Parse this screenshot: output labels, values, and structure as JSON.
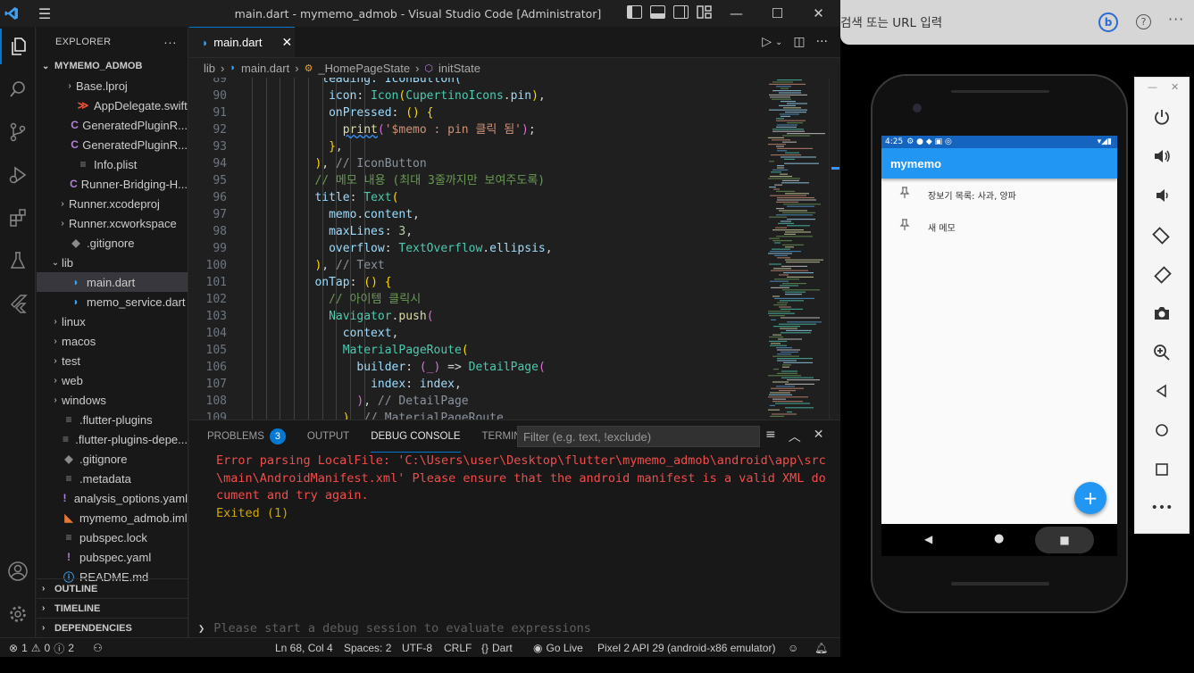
{
  "window": {
    "title": "main.dart - mymemo_admob - Visual Studio Code [Administrator]",
    "controls": {
      "minimize": "—",
      "maximize": "☐",
      "close": "✕"
    }
  },
  "activity_bar": [
    "explorer-icon",
    "search-icon",
    "source-control-icon",
    "run-debug-icon",
    "extensions-icon",
    "testing-icon",
    "flutter-icon",
    "account-icon",
    "settings-gear-icon"
  ],
  "sidebar": {
    "header": "EXPLORER",
    "more": "···",
    "root": "MYMEMO_ADMOB",
    "items": [
      {
        "label": "Base.lproj",
        "icon": "",
        "chevron": "›",
        "indent": 2
      },
      {
        "label": "AppDelegate.swift",
        "icon": "swift",
        "chevron": "",
        "indent": 2
      },
      {
        "label": "GeneratedPluginR...",
        "icon": "C",
        "chevron": "",
        "indent": 2
      },
      {
        "label": "GeneratedPluginR...",
        "icon": "C",
        "chevron": "",
        "indent": 2
      },
      {
        "label": "Info.plist",
        "icon": "≡",
        "chevron": "",
        "indent": 2
      },
      {
        "label": "Runner-Bridging-H...",
        "icon": "C",
        "chevron": "",
        "indent": 2
      },
      {
        "label": "Runner.xcodeproj",
        "icon": "",
        "chevron": "›",
        "indent": 1
      },
      {
        "label": "Runner.xcworkspace",
        "icon": "",
        "chevron": "›",
        "indent": 1
      },
      {
        "label": ".gitignore",
        "icon": "◆",
        "chevron": "",
        "indent": 1
      },
      {
        "label": "lib",
        "icon": "",
        "chevron": "⌄",
        "indent": 0
      },
      {
        "label": "main.dart",
        "icon": "dart",
        "chevron": "",
        "indent": 1,
        "selected": true
      },
      {
        "label": "memo_service.dart",
        "icon": "dart",
        "chevron": "",
        "indent": 1
      },
      {
        "label": "linux",
        "icon": "",
        "chevron": "›",
        "indent": 0
      },
      {
        "label": "macos",
        "icon": "",
        "chevron": "›",
        "indent": 0
      },
      {
        "label": "test",
        "icon": "",
        "chevron": "›",
        "indent": 0
      },
      {
        "label": "web",
        "icon": "",
        "chevron": "›",
        "indent": 0
      },
      {
        "label": "windows",
        "icon": "",
        "chevron": "›",
        "indent": 0
      },
      {
        "label": ".flutter-plugins",
        "icon": "≡",
        "chevron": "",
        "indent": 0
      },
      {
        "label": ".flutter-plugins-depe...",
        "icon": "≡",
        "chevron": "",
        "indent": 0
      },
      {
        "label": ".gitignore",
        "icon": "◆",
        "chevron": "",
        "indent": 0
      },
      {
        "label": ".metadata",
        "icon": "≡",
        "chevron": "",
        "indent": 0
      },
      {
        "label": "analysis_options.yaml",
        "icon": "!",
        "chevron": "",
        "indent": 0
      },
      {
        "label": "mymemo_admob.iml",
        "icon": "rss",
        "chevron": "",
        "indent": 0
      },
      {
        "label": "pubspec.lock",
        "icon": "≡",
        "chevron": "",
        "indent": 0
      },
      {
        "label": "pubspec.yaml",
        "icon": "!",
        "chevron": "",
        "indent": 0
      },
      {
        "label": "README.md",
        "icon": "ⓘ",
        "chevron": "",
        "indent": 0
      }
    ],
    "sections": [
      "OUTLINE",
      "TIMELINE",
      "DEPENDENCIES"
    ]
  },
  "editor": {
    "tab": "main.dart",
    "breadcrumb": [
      "lib",
      "main.dart",
      "_HomePageState",
      "initState"
    ],
    "lines": [
      {
        "n": "89",
        "html": "          leading: IconButton("
      },
      {
        "n": "90",
        "indent": 11,
        "tokens": [
          [
            "prop",
            "icon"
          ],
          [
            "p",
            ": "
          ],
          [
            "cls",
            "Icon"
          ],
          [
            "br",
            "("
          ],
          [
            "cls",
            "CupertinoIcons"
          ],
          [
            "p",
            "."
          ],
          [
            "prop",
            "pin"
          ],
          [
            "br",
            ")"
          ],
          [
            "p",
            ","
          ]
        ]
      },
      {
        "n": "91",
        "indent": 11,
        "tokens": [
          [
            "prop",
            "onPressed"
          ],
          [
            "p",
            ": "
          ],
          [
            "br",
            "() {"
          ]
        ]
      },
      {
        "n": "92",
        "indent": 13,
        "tokens": [
          [
            "fn",
            "print"
          ],
          [
            "br2",
            "("
          ],
          [
            "str",
            "'$memo : pin 클릭 됨'"
          ],
          [
            "br2",
            ")"
          ],
          [
            "p",
            ";"
          ]
        ]
      },
      {
        "n": "93",
        "indent": 11,
        "tokens": [
          [
            "br",
            "}"
          ],
          [
            "p",
            ","
          ]
        ]
      },
      {
        "n": "94",
        "indent": 9,
        "tokens": [
          [
            "br",
            ")"
          ],
          [
            "p",
            ", "
          ],
          [
            "cmtg",
            "// IconButton"
          ]
        ]
      },
      {
        "n": "95",
        "indent": 9,
        "tokens": [
          [
            "cmt",
            "// 메모 내용 (최대 3줄까지만 보여주도록)"
          ]
        ]
      },
      {
        "n": "96",
        "indent": 9,
        "tokens": [
          [
            "prop",
            "title"
          ],
          [
            "p",
            ": "
          ],
          [
            "cls",
            "Text"
          ],
          [
            "br",
            "("
          ]
        ]
      },
      {
        "n": "97",
        "indent": 11,
        "tokens": [
          [
            "prop",
            "memo"
          ],
          [
            "p",
            "."
          ],
          [
            "prop",
            "content"
          ],
          [
            "p",
            ","
          ]
        ]
      },
      {
        "n": "98",
        "indent": 11,
        "tokens": [
          [
            "prop",
            "maxLines"
          ],
          [
            "p",
            ": "
          ],
          [
            "num",
            "3"
          ],
          [
            "p",
            ","
          ]
        ]
      },
      {
        "n": "99",
        "indent": 11,
        "tokens": [
          [
            "prop",
            "overflow"
          ],
          [
            "p",
            ": "
          ],
          [
            "cls",
            "TextOverflow"
          ],
          [
            "p",
            "."
          ],
          [
            "prop",
            "ellipsis"
          ],
          [
            "p",
            ","
          ]
        ]
      },
      {
        "n": "100",
        "indent": 9,
        "tokens": [
          [
            "br",
            ")"
          ],
          [
            "p",
            ", "
          ],
          [
            "cmtg",
            "// Text"
          ]
        ]
      },
      {
        "n": "101",
        "indent": 9,
        "tokens": [
          [
            "prop",
            "onTap"
          ],
          [
            "p",
            ": "
          ],
          [
            "br",
            "() {"
          ]
        ]
      },
      {
        "n": "102",
        "indent": 11,
        "tokens": [
          [
            "cmt",
            "// 아이템 클릭시"
          ]
        ]
      },
      {
        "n": "103",
        "indent": 11,
        "tokens": [
          [
            "cls",
            "Navigator"
          ],
          [
            "p",
            "."
          ],
          [
            "fn",
            "push"
          ],
          [
            "br2",
            "("
          ]
        ]
      },
      {
        "n": "104",
        "indent": 13,
        "tokens": [
          [
            "prop",
            "context"
          ],
          [
            "p",
            ","
          ]
        ]
      },
      {
        "n": "105",
        "indent": 13,
        "tokens": [
          [
            "cls",
            "MaterialPageRoute"
          ],
          [
            "br",
            "("
          ]
        ]
      },
      {
        "n": "106",
        "indent": 15,
        "tokens": [
          [
            "prop",
            "builder"
          ],
          [
            "p",
            ": "
          ],
          [
            "br2",
            "(_)"
          ],
          [
            "p",
            " => "
          ],
          [
            "cls",
            "DetailPage"
          ],
          [
            "br2",
            "("
          ]
        ]
      },
      {
        "n": "107",
        "indent": 17,
        "tokens": [
          [
            "prop",
            "index"
          ],
          [
            "p",
            ": "
          ],
          [
            "prop",
            "index"
          ],
          [
            "p",
            ","
          ]
        ]
      },
      {
        "n": "108",
        "indent": 15,
        "tokens": [
          [
            "br2",
            ")"
          ],
          [
            "p",
            ", "
          ],
          [
            "cmtg",
            "// DetailPage"
          ]
        ]
      },
      {
        "n": "109",
        "indent": 13,
        "tokens": [
          [
            "br",
            ")"
          ],
          [
            "p",
            ", "
          ],
          [
            "cmtg",
            "// MaterialPageRoute"
          ]
        ]
      }
    ]
  },
  "panel": {
    "tabs": [
      {
        "label": "PROBLEMS",
        "badge": "3"
      },
      {
        "label": "OUTPUT"
      },
      {
        "label": "DEBUG CONSOLE",
        "active": true
      },
      {
        "label": "TERMINAL"
      }
    ],
    "filter_placeholder": "Filter (e.g. text, !exclude)",
    "error": "Error parsing LocalFile: 'C:\\Users\\user\\Desktop\\flutter\\mymemo_admob\\android\\app\\src\\main\\AndroidManifest.xml' Please ensure that the android manifest is a valid XML document and try again.",
    "exit": "Exited (1)",
    "eval_placeholder": "Please start a debug session to evaluate expressions"
  },
  "statusbar": {
    "errors": "1",
    "warnings": "0",
    "infos": "2",
    "position": "Ln 68, Col 4",
    "spaces": "Spaces: 2",
    "encoding": "UTF-8",
    "eol": "CRLF",
    "language": "Dart",
    "golive": "Go Live",
    "device": "Pixel 2 API 29 (android-x86 emulator)"
  },
  "browser": {
    "address_placeholder": "검색 또는 URL 입력",
    "bing": "b",
    "help": "?",
    "more": "···"
  },
  "phone": {
    "time": "4:25",
    "app_title": "mymemo",
    "memos": [
      "장보기 목록: 사과, 양파",
      "새 메모"
    ],
    "fab": "+",
    "accent": "#2196f3"
  },
  "emulator_controls": [
    "power-icon",
    "volume-up-icon",
    "volume-down-icon",
    "rotate-left-icon",
    "rotate-right-icon",
    "camera-icon",
    "zoom-icon",
    "back-icon",
    "home-icon",
    "overview-icon",
    "more-icon"
  ]
}
